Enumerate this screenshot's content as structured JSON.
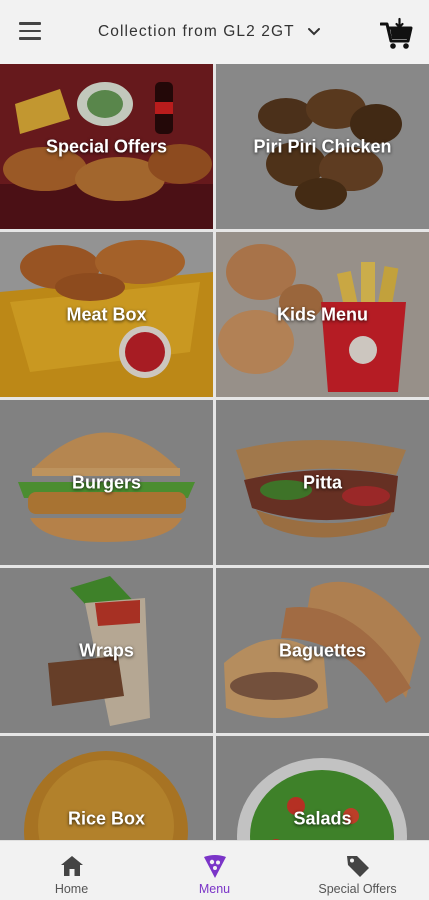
{
  "header": {
    "collection_label": "Collection from GL2 2GT",
    "icons": {
      "menu": "hamburger-icon",
      "dropdown": "chevron-down-icon",
      "cart": "cart-icon"
    }
  },
  "categories": [
    {
      "label": "Special Offers"
    },
    {
      "label": "Piri Piri Chicken"
    },
    {
      "label": "Meat Box"
    },
    {
      "label": "Kids Menu"
    },
    {
      "label": "Burgers"
    },
    {
      "label": "Pitta"
    },
    {
      "label": "Wraps"
    },
    {
      "label": "Baguettes"
    },
    {
      "label": "Rice Box"
    },
    {
      "label": "Salads"
    }
  ],
  "bottom_nav": {
    "items": [
      {
        "label": "Home",
        "icon": "home-icon",
        "active": false
      },
      {
        "label": "Menu",
        "icon": "pizza-slice-icon",
        "active": true
      },
      {
        "label": "Special Offers",
        "icon": "tag-icon",
        "active": false
      }
    ]
  },
  "colors": {
    "accent": "#7b35c8",
    "header_bg": "#f2f2f2",
    "tile_grey": "#9a9a9a"
  }
}
